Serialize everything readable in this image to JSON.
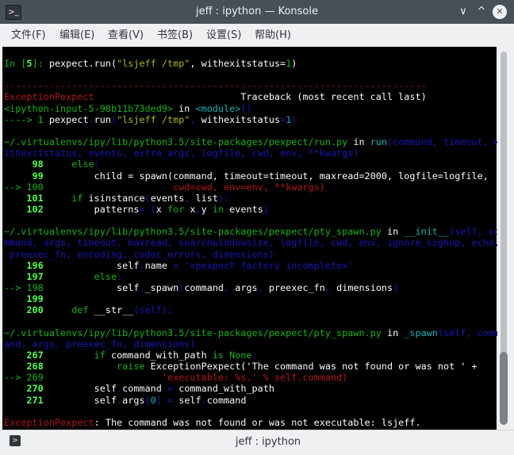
{
  "window": {
    "title": "jeff : ipython — Konsole",
    "app_icon": "terminal-icon"
  },
  "window_controls": {
    "minimize": "∨",
    "maximize": "^",
    "close": "✕"
  },
  "menu": [
    {
      "label": "文件(F)"
    },
    {
      "label": "编辑(E)"
    },
    {
      "label": "查看(V)"
    },
    {
      "label": "书签(B)"
    },
    {
      "label": "设置(S)"
    },
    {
      "label": "帮助(H)"
    }
  ],
  "colors": {
    "green": "#18b218",
    "bright_green": "#54ff54",
    "red": "#b21818",
    "blue": "#1818b2",
    "cyan": "#18b2b2",
    "yellow": "#b2b218",
    "white": "#fcfcfc"
  },
  "terminal": {
    "lines": [
      [
        {
          "t": "In [",
          "c": "g"
        },
        {
          "t": "5",
          "c": "bg"
        },
        {
          "t": "]: ",
          "c": "g"
        },
        {
          "t": "pexpect.run(",
          "c": "w"
        },
        {
          "t": "\"lsjeff /tmp\"",
          "c": "y"
        },
        {
          "t": ", withexitstatus=",
          "c": "w"
        },
        {
          "t": "1",
          "c": "g"
        },
        {
          "t": ")",
          "c": "w"
        }
      ],
      [],
      [
        {
          "t": "---------------------------------------------------------------------------",
          "c": "r"
        }
      ],
      [
        {
          "t": "ExceptionPexpect",
          "c": "r"
        },
        {
          "t": "                          Traceback (most recent call last)",
          "c": "w"
        }
      ],
      [
        {
          "t": "<ipython-input-5-98b11b73ded9>",
          "c": "g"
        },
        {
          "t": " in ",
          "c": "w"
        },
        {
          "t": "<module>",
          "c": "c"
        },
        {
          "t": "()",
          "c": "b"
        }
      ],
      [
        {
          "t": "----> 1 ",
          "c": "g"
        },
        {
          "t": "pexpect",
          "c": "w"
        },
        {
          "t": ".",
          "c": "b"
        },
        {
          "t": "run",
          "c": "w"
        },
        {
          "t": "(",
          "c": "b"
        },
        {
          "t": "\"lsjeff /tmp\"",
          "c": "y"
        },
        {
          "t": ",",
          "c": "b"
        },
        {
          "t": " withexitstatus",
          "c": "w"
        },
        {
          "t": "=",
          "c": "b"
        },
        {
          "t": "1",
          "c": "c"
        },
        {
          "t": ")",
          "c": "b"
        }
      ],
      [],
      [
        {
          "t": "~/.virtualenvs/ipy/lib/python3.5/site-packages/pexpect/run.py",
          "c": "g"
        },
        {
          "t": " in ",
          "c": "w"
        },
        {
          "t": "run",
          "c": "c"
        },
        {
          "t": "(command, timeout, w",
          "c": "b"
        }
      ],
      [
        {
          "t": "ithexitstatus, events, extra_args, logfile, cwd, env, **kwargs)",
          "c": "b"
        }
      ],
      [
        {
          "t": "     98 ",
          "c": "bg"
        },
        {
          "t": "    else",
          "c": "g"
        },
        {
          "t": ":",
          "c": "b"
        }
      ],
      [
        {
          "t": "     99 ",
          "c": "bg"
        },
        {
          "t": "        child = spawn(command, timeout=timeout, maxread=2000, logfile=logfile,",
          "c": "w"
        }
      ],
      [
        {
          "t": "--> 100 ",
          "c": "g"
        },
        {
          "t": "                      cwd=cwd, env=env, **kwargs)",
          "c": "r"
        }
      ],
      [
        {
          "t": "    101 ",
          "c": "bg"
        },
        {
          "t": "    if ",
          "c": "g"
        },
        {
          "t": "isinstance",
          "c": "w"
        },
        {
          "t": "(",
          "c": "b"
        },
        {
          "t": "events",
          "c": "w"
        },
        {
          "t": ",",
          "c": "b"
        },
        {
          "t": " list",
          "c": "w"
        },
        {
          "t": "):",
          "c": "b"
        }
      ],
      [
        {
          "t": "    102 ",
          "c": "bg"
        },
        {
          "t": "        patterns",
          "c": "w"
        },
        {
          "t": "= [",
          "c": "b"
        },
        {
          "t": "x ",
          "c": "w"
        },
        {
          "t": "for ",
          "c": "g"
        },
        {
          "t": "x",
          "c": "w"
        },
        {
          "t": ",",
          "c": "b"
        },
        {
          "t": "y ",
          "c": "w"
        },
        {
          "t": "in ",
          "c": "g"
        },
        {
          "t": "events",
          "c": "w"
        },
        {
          "t": "]",
          "c": "b"
        }
      ],
      [],
      [
        {
          "t": "~/.virtualenvs/ipy/lib/python3.5/site-packages/pexpect/pty_spawn.py",
          "c": "g"
        },
        {
          "t": " in ",
          "c": "w"
        },
        {
          "t": "__init__",
          "c": "c"
        },
        {
          "t": "(self, co",
          "c": "b"
        }
      ],
      [
        {
          "t": "mmand, args, timeout, maxread, searchwindowsize, logfile, cwd, env, ignore_sighup, echo,",
          "c": "b"
        }
      ],
      [
        {
          "t": " preexec_fn, encoding, codec_errors, dimensions)",
          "c": "b"
        }
      ],
      [
        {
          "t": "    196 ",
          "c": "bg"
        },
        {
          "t": "            self",
          "c": "w"
        },
        {
          "t": ".",
          "c": "b"
        },
        {
          "t": "name ",
          "c": "w"
        },
        {
          "t": "= ",
          "c": "b"
        },
        {
          "t": "'<pexpect factory incomplete>'",
          "c": "b"
        }
      ],
      [
        {
          "t": "    197 ",
          "c": "bg"
        },
        {
          "t": "        else",
          "c": "g"
        },
        {
          "t": ":",
          "c": "b"
        }
      ],
      [
        {
          "t": "--> 198 ",
          "c": "g"
        },
        {
          "t": "            self",
          "c": "w"
        },
        {
          "t": ".",
          "c": "b"
        },
        {
          "t": "_spawn",
          "c": "w"
        },
        {
          "t": "(",
          "c": "b"
        },
        {
          "t": "command",
          "c": "w"
        },
        {
          "t": ",",
          "c": "b"
        },
        {
          "t": " args",
          "c": "w"
        },
        {
          "t": ",",
          "c": "b"
        },
        {
          "t": " preexec_fn",
          "c": "w"
        },
        {
          "t": ",",
          "c": "b"
        },
        {
          "t": " dimensions",
          "c": "w"
        },
        {
          "t": ")",
          "c": "b"
        }
      ],
      [
        {
          "t": "    199 ",
          "c": "bg"
        }
      ],
      [
        {
          "t": "    200 ",
          "c": "bg"
        },
        {
          "t": "    def ",
          "c": "g"
        },
        {
          "t": "__str__",
          "c": "w"
        },
        {
          "t": "(self):",
          "c": "b"
        }
      ],
      [],
      [
        {
          "t": "~/.virtualenvs/ipy/lib/python3.5/site-packages/pexpect/pty_spawn.py",
          "c": "g"
        },
        {
          "t": " in ",
          "c": "w"
        },
        {
          "t": "_spawn",
          "c": "c"
        },
        {
          "t": "(self, comm",
          "c": "b"
        }
      ],
      [
        {
          "t": "and, args, preexec_fn, dimensions)",
          "c": "b"
        }
      ],
      [
        {
          "t": "    267 ",
          "c": "bg"
        },
        {
          "t": "        if ",
          "c": "g"
        },
        {
          "t": "command_with_path ",
          "c": "w"
        },
        {
          "t": "is ",
          "c": "g"
        },
        {
          "t": "None",
          "c": "g"
        },
        {
          "t": ":",
          "c": "b"
        }
      ],
      [
        {
          "t": "    268 ",
          "c": "bg"
        },
        {
          "t": "            raise ",
          "c": "g"
        },
        {
          "t": "ExceptionPexpect('The command was not found or was not ' +",
          "c": "w"
        }
      ],
      [
        {
          "t": "--> 269 ",
          "c": "g"
        },
        {
          "t": "                    'executable: %s.' % self.command)",
          "c": "r"
        }
      ],
      [
        {
          "t": "    270 ",
          "c": "bg"
        },
        {
          "t": "        self",
          "c": "w"
        },
        {
          "t": ".",
          "c": "b"
        },
        {
          "t": "command ",
          "c": "w"
        },
        {
          "t": "= ",
          "c": "b"
        },
        {
          "t": "command_with_path",
          "c": "w"
        }
      ],
      [
        {
          "t": "    271 ",
          "c": "bg"
        },
        {
          "t": "        self",
          "c": "w"
        },
        {
          "t": ".",
          "c": "b"
        },
        {
          "t": "args",
          "c": "w"
        },
        {
          "t": "[",
          "c": "b"
        },
        {
          "t": "0",
          "c": "c"
        },
        {
          "t": "] = ",
          "c": "b"
        },
        {
          "t": "self",
          "c": "w"
        },
        {
          "t": ".",
          "c": "b"
        },
        {
          "t": "command",
          "c": "w"
        }
      ],
      [],
      [
        {
          "t": "ExceptionPexpect",
          "c": "r"
        },
        {
          "t": ": The command was not found or was not executable: lsjeff.",
          "c": "w"
        }
      ]
    ]
  },
  "tabbar": {
    "tab_label": "jeff : ipython",
    "tab_icon": "terminal-icon"
  }
}
